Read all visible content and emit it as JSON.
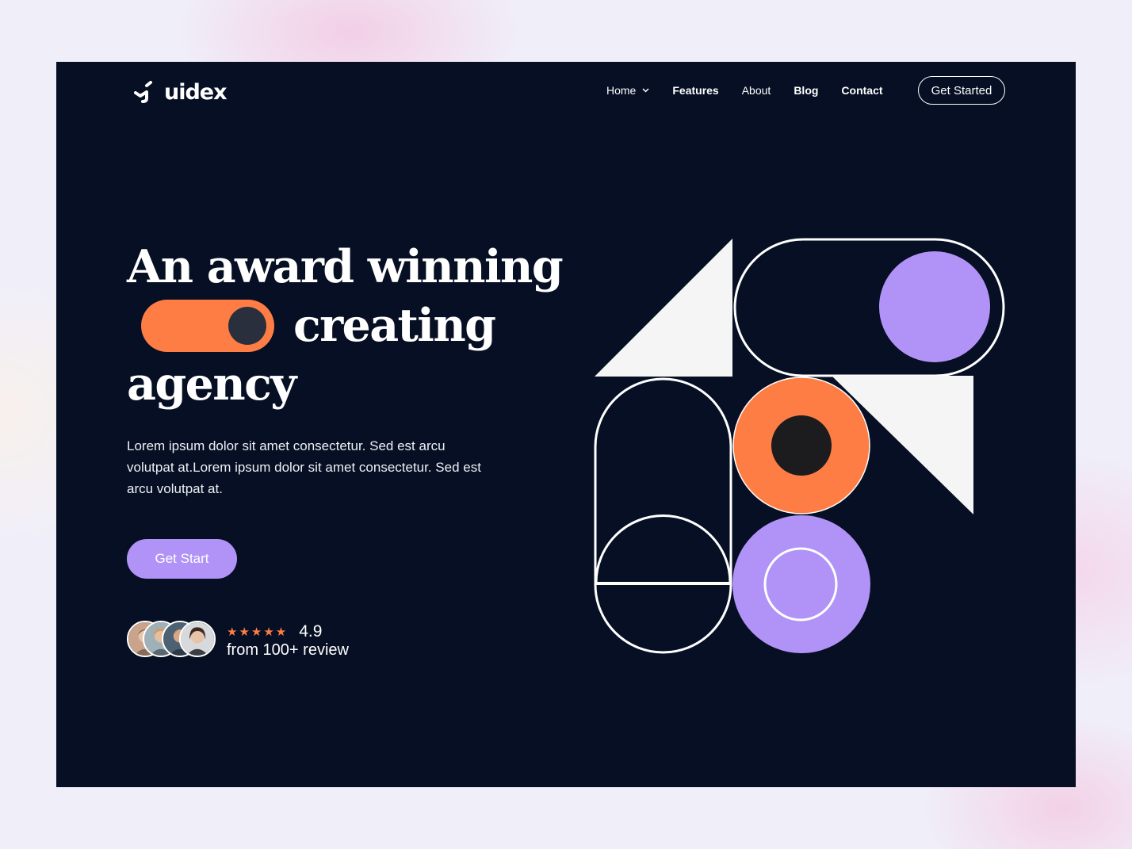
{
  "brand": {
    "name": "uidex",
    "logo_icon": "uidex-logo-mark"
  },
  "nav": {
    "items": [
      {
        "label": "Home",
        "has_dropdown": true
      },
      {
        "label": "Features",
        "has_dropdown": false
      },
      {
        "label": "About",
        "has_dropdown": false
      },
      {
        "label": "Blog",
        "has_dropdown": false
      },
      {
        "label": "Contact",
        "has_dropdown": false
      }
    ],
    "cta_label": "Get Started"
  },
  "hero": {
    "headline_line1": "An award winning",
    "headline_line2": "creating",
    "headline_line3": "agency",
    "description": "Lorem ipsum dolor sit amet consectetur. Sed est arcu volutpat at.Lorem ipsum dolor sit amet consectetur. Sed est arcu volutpat at.",
    "cta_label": "Get Start",
    "rating": {
      "stars": 5,
      "star_glyphs": "★★★★★",
      "score": "4.9",
      "caption": "from 100+ review"
    },
    "avatar_count": 4
  },
  "colors": {
    "page_background": "#f0eff9",
    "hero_background": "#060f23",
    "orange": "#fe7d45",
    "purple": "#b193f7",
    "off_white": "#f5f5f5",
    "dark_dot": "#1c1c1e"
  }
}
